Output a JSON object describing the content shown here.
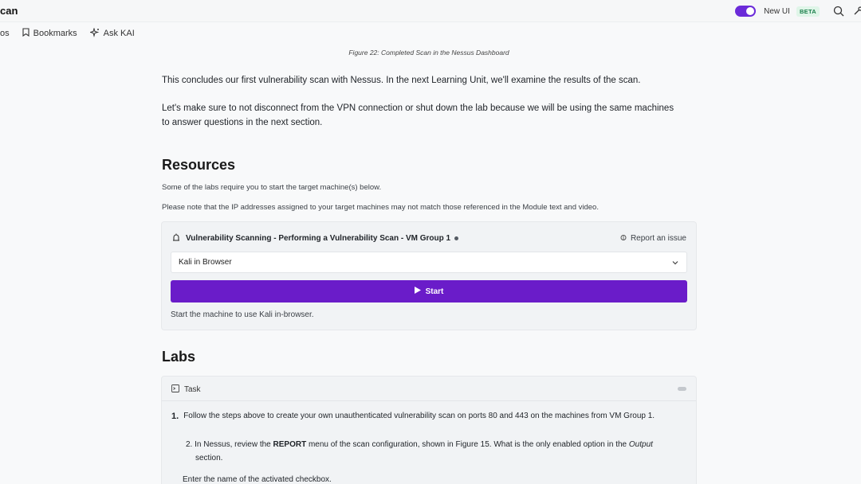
{
  "topbar": {
    "title": "can",
    "new_ui_label": "New UI",
    "beta_label": "BETA"
  },
  "subnav": {
    "items": [
      {
        "label": "os"
      },
      {
        "label": "Bookmarks"
      },
      {
        "label": "Ask KAI"
      }
    ]
  },
  "caption": "Figure 22: Completed Scan in the Nessus Dashboard",
  "paragraphs": {
    "p1": "This concludes our first vulnerability scan with Nessus. In the next Learning Unit, we'll examine the results of the scan.",
    "p2a": "Let's make sure to not disconnect from the VPN connection or shut down the lab because we will be using the same machines",
    "p2b": "to answer questions in the next section."
  },
  "resources": {
    "heading": "Resources",
    "note1": "Some of the labs require you to start the target machine(s) below.",
    "note2": "Please note that the IP addresses assigned to your target machines may not match those referenced in the Module text and video.",
    "vm": {
      "title": "Vulnerability Scanning - Performing a Vulnerability Scan - VM Group 1",
      "report_label": "Report an issue",
      "select_value": "Kali in Browser",
      "start_label": "Start",
      "note": "Start the machine to use Kali in-browser."
    }
  },
  "labs": {
    "heading": "Labs",
    "task_label": "Task",
    "q1_num": "1.",
    "q1_text": "Follow the steps above to create your own unauthenticated vulnerability scan on ports 80 and 443 on the machines from VM Group 1.",
    "q2_num": "2.",
    "q2_pre": "In Nessus, review the",
    "q2_bold": "REPORT",
    "q2_mid": "menu of the scan configuration, shown in Figure 15. What is the only enabled option in the",
    "q2_italic": "Output",
    "q2_post": "section.",
    "q3_text": "Enter the name of the activated checkbox."
  },
  "colors": {
    "accent": "#6a1cc9",
    "toggle": "#6b2bd9",
    "beta_bg": "#dff5e8",
    "beta_fg": "#1a7f4b"
  }
}
